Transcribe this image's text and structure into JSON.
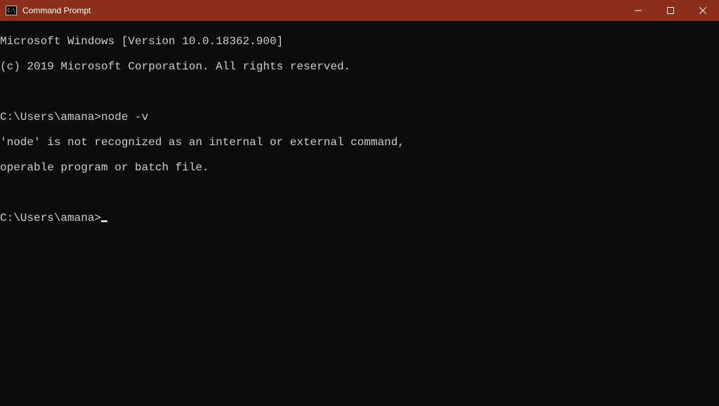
{
  "window": {
    "title": "Command Prompt",
    "icon_label": "cmd"
  },
  "terminal": {
    "lines": [
      "Microsoft Windows [Version 10.0.18362.900]",
      "(c) 2019 Microsoft Corporation. All rights reserved.",
      "",
      "C:\\Users\\amana>node -v",
      "'node' is not recognized as an internal or external command,",
      "operable program or batch file.",
      "",
      "C:\\Users\\amana>"
    ]
  }
}
